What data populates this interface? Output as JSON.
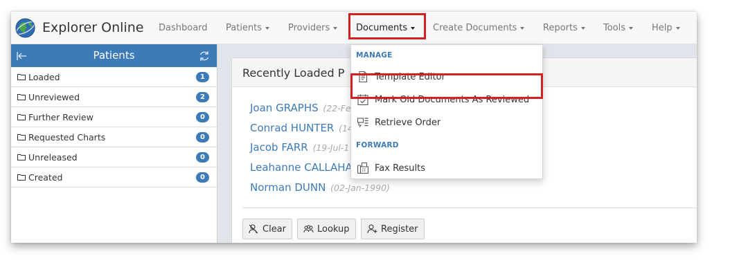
{
  "app": {
    "name": "Explorer Online"
  },
  "navbar": {
    "items": [
      {
        "label": "Dashboard",
        "dropdown": false
      },
      {
        "label": "Patients",
        "dropdown": true
      },
      {
        "label": "Providers",
        "dropdown": true
      },
      {
        "label": "Documents",
        "dropdown": true,
        "active": true
      },
      {
        "label": "Create Documents",
        "dropdown": true
      },
      {
        "label": "Reports",
        "dropdown": true
      },
      {
        "label": "Tools",
        "dropdown": true
      },
      {
        "label": "Help",
        "dropdown": true
      }
    ]
  },
  "sidebar": {
    "title": "Patients",
    "items": [
      {
        "label": "Loaded",
        "count": "1"
      },
      {
        "label": "Unreviewed",
        "count": "2"
      },
      {
        "label": "Further Review",
        "count": "0"
      },
      {
        "label": "Requested Charts",
        "count": "0"
      },
      {
        "label": "Unreleased",
        "count": "0"
      },
      {
        "label": "Created",
        "count": "0"
      }
    ]
  },
  "panel": {
    "title": "Recently Loaded P",
    "patients": [
      {
        "name": "Joan GRAPHS",
        "dob": "(22-Fe"
      },
      {
        "name": "Conrad HUNTER",
        "dob": "(14"
      },
      {
        "name": "Jacob FARR",
        "dob": "(19-Jul-1"
      },
      {
        "name": "Leahanne CALLAHA",
        "dob": ""
      },
      {
        "name": "Norman DUNN",
        "dob": "(02-Jan-1990)"
      }
    ],
    "buttons": {
      "clear": "Clear",
      "lookup": "Lookup",
      "register": "Register"
    }
  },
  "documents_menu": {
    "manage_header": "MANAGE",
    "manage_items": [
      {
        "label": "Template Editor",
        "icon": "document-icon"
      },
      {
        "label": "Mark Old Documents As Reviewed",
        "icon": "calendar-check-icon"
      },
      {
        "label": "Retrieve Order",
        "icon": "retrieve-order-icon"
      }
    ],
    "forward_header": "FORWARD",
    "forward_items": [
      {
        "label": "Fax Results",
        "icon": "fax-icon"
      }
    ]
  },
  "colors": {
    "accent": "#3c7ab8",
    "highlight": "#d42020",
    "navbar_bg": "#f8f8f8"
  }
}
